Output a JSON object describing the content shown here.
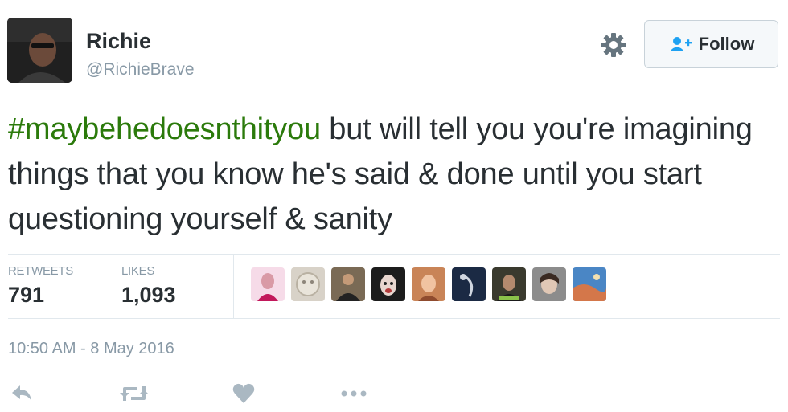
{
  "user": {
    "display_name": "Richie",
    "handle": "@RichieBrave"
  },
  "follow_button": {
    "label": "Follow"
  },
  "tweet": {
    "hashtag": "#maybehedoesnthityou",
    "text": " but will tell you you're imagining things that you know he's said & done until you start questioning yourself & sanity"
  },
  "stats": {
    "retweets_label": "RETWEETS",
    "retweets_value": "791",
    "likes_label": "LIKES",
    "likes_value": "1,093"
  },
  "likers": [
    "liker-avatar",
    "liker-avatar",
    "liker-avatar",
    "liker-avatar",
    "liker-avatar",
    "liker-avatar",
    "liker-avatar",
    "liker-avatar",
    "liker-avatar"
  ],
  "timestamp": "10:50 AM - 8 May 2016",
  "actions": [
    "reply-icon",
    "retweet-icon",
    "like-icon",
    "more-icon"
  ],
  "colors": {
    "hashtag": "#2b7a0b",
    "muted": "#8899a6",
    "text": "#292f33",
    "follow_icon": "#1da1f2"
  }
}
